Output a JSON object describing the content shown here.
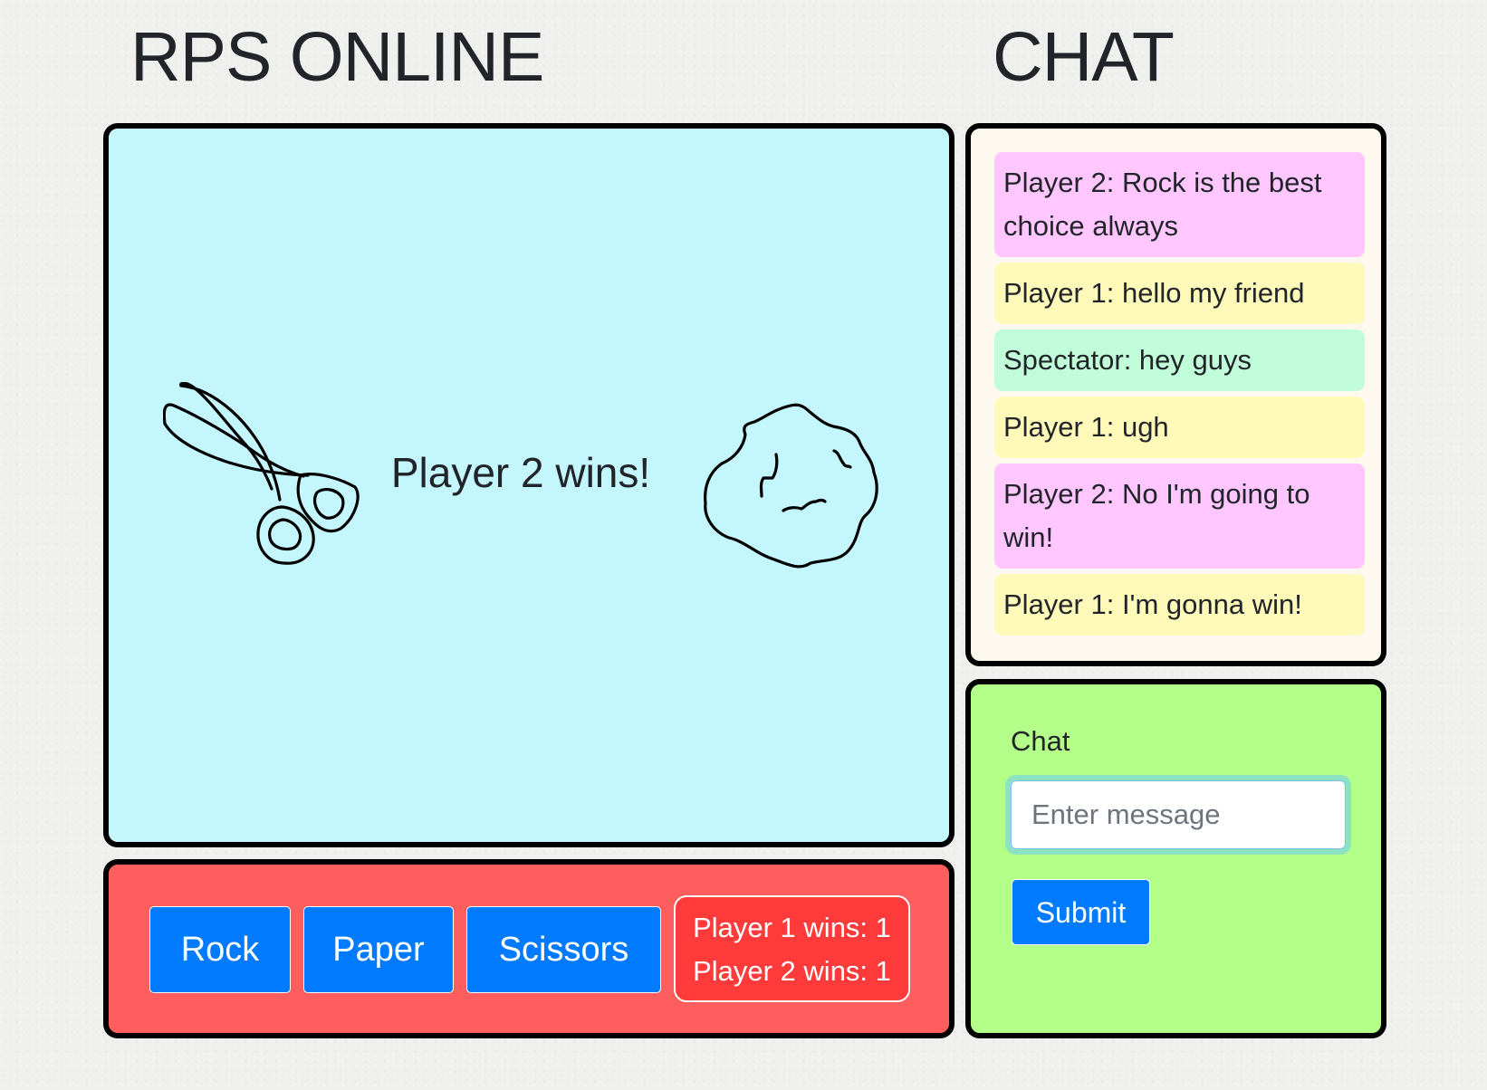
{
  "header": {
    "game_title": "RPS ONLINE",
    "chat_title": "CHAT"
  },
  "game": {
    "result_text": "Player 2 wins!",
    "player1_hand_icon": "scissors-drawing-icon",
    "player2_hand_icon": "rock-drawing-icon"
  },
  "controls": {
    "rock_label": "Rock",
    "paper_label": "Paper",
    "scissors_label": "Scissors",
    "score": {
      "player1": "Player 1 wins: 1",
      "player2": "Player 2 wins: 1"
    }
  },
  "chat": {
    "messages": [
      {
        "text": "Player 2: Rock is the best choice always",
        "sender": "Player 2"
      },
      {
        "text": "Player 1: hello my friend",
        "sender": "Player 1"
      },
      {
        "text": "Spectator: hey guys",
        "sender": "Spectator"
      },
      {
        "text": "Player 1: ugh",
        "sender": "Player 1"
      },
      {
        "text": "Player 2: No I'm going to win!",
        "sender": "Player 2"
      },
      {
        "text": "Player 1: I'm gonna win!",
        "sender": "Player 1"
      }
    ],
    "form": {
      "label": "Chat",
      "placeholder": "Enter message",
      "value": "",
      "submit_label": "Submit"
    }
  },
  "colors": {
    "game_stage_bg": "#c4f6fe",
    "controls_bg": "#ff5e5e",
    "score_bg": "#ff3a3a",
    "chat_log_bg": "#fdf9ee",
    "chat_form_bg": "#b4ff8a",
    "button_primary": "#007bff",
    "player1_message": "#fffaba",
    "player2_message": "#ffc6ff",
    "spectator_message": "#c1fdd9"
  }
}
